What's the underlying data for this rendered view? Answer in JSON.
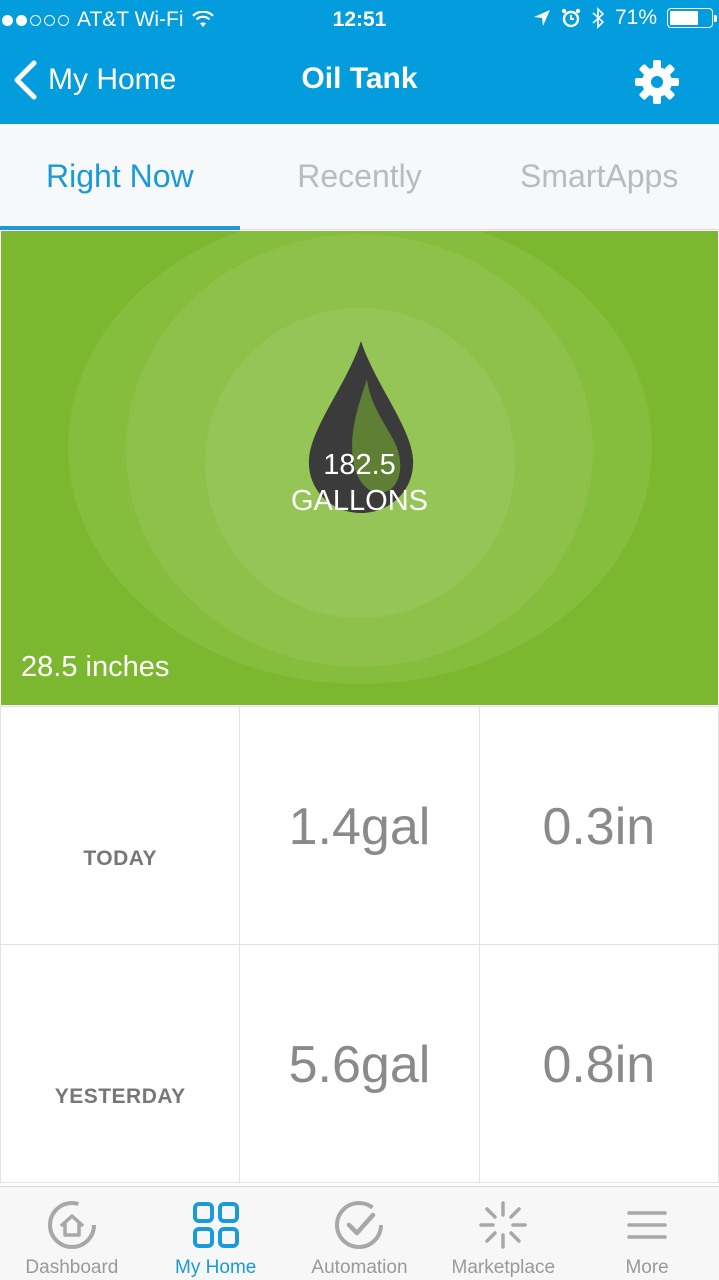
{
  "status_bar": {
    "carrier": "AT&T Wi-Fi",
    "time": "12:51",
    "battery": "71%",
    "battery_level": 0.71,
    "signal_bars_filled": 2,
    "signal_bars_total": 5
  },
  "header": {
    "back_label": "My Home",
    "title": "Oil Tank"
  },
  "tabs": [
    {
      "label": "Right Now",
      "active": true
    },
    {
      "label": "Recently",
      "active": false
    },
    {
      "label": "SmartApps",
      "active": false
    }
  ],
  "tile": {
    "value": "182.5",
    "unit": "GALLONS",
    "secondary": "28.5 inches",
    "background_color": "#7cb82f",
    "icon": "oil-drop-icon"
  },
  "stats": [
    {
      "label": "TODAY",
      "gallons": "1.4gal",
      "inches": "0.3in"
    },
    {
      "label": "YESTERDAY",
      "gallons": "5.6gal",
      "inches": "0.8in"
    }
  ],
  "bottom_nav": [
    {
      "label": "Dashboard",
      "icon": "dashboard-icon",
      "active": false
    },
    {
      "label": "My Home",
      "icon": "my-home-grid-icon",
      "active": true
    },
    {
      "label": "Automation",
      "icon": "automation-check-icon",
      "active": false
    },
    {
      "label": "Marketplace",
      "icon": "marketplace-burst-icon",
      "active": false
    },
    {
      "label": "More",
      "icon": "menu-icon",
      "active": false
    }
  ],
  "colors": {
    "header": "#039cdc",
    "accent": "#1a9ad8",
    "tile_green": "#7cb82f"
  }
}
